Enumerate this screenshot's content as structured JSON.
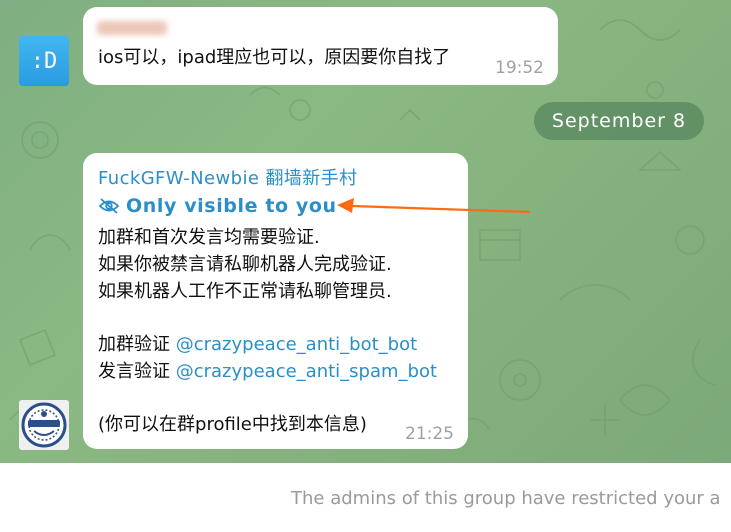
{
  "messages": [
    {
      "time": "19:52",
      "text": "ios可以，ipad理应也可以，原因要你自找了",
      "avatar_text": ":D"
    },
    {
      "sender": "FuckGFW-Newbie 翻墙新手村",
      "visibility": "Only visible to you",
      "lines": [
        "加群和首次发言均需要验证.",
        "如果你被禁言请私聊机器人完成验证.",
        "如果机器人工作不正常请私聊管理员."
      ],
      "join_prefix": "加群验证",
      "join_bot": "@crazypeace_anti_bot_bot",
      "speak_prefix": "发言验证",
      "speak_bot": "@crazypeace_anti_spam_bot",
      "footer": "(你可以在群profile中找到本信息)",
      "time": "21:25"
    }
  ],
  "date_separator": "September 8",
  "restricted_notice": "The admins of this group have restricted your a",
  "colors": {
    "link": "#2a8fc9",
    "arrow": "#ff6a13",
    "background": "#86b27e"
  },
  "icons": [
    "eye-off-icon",
    "laughing-man-avatar"
  ]
}
